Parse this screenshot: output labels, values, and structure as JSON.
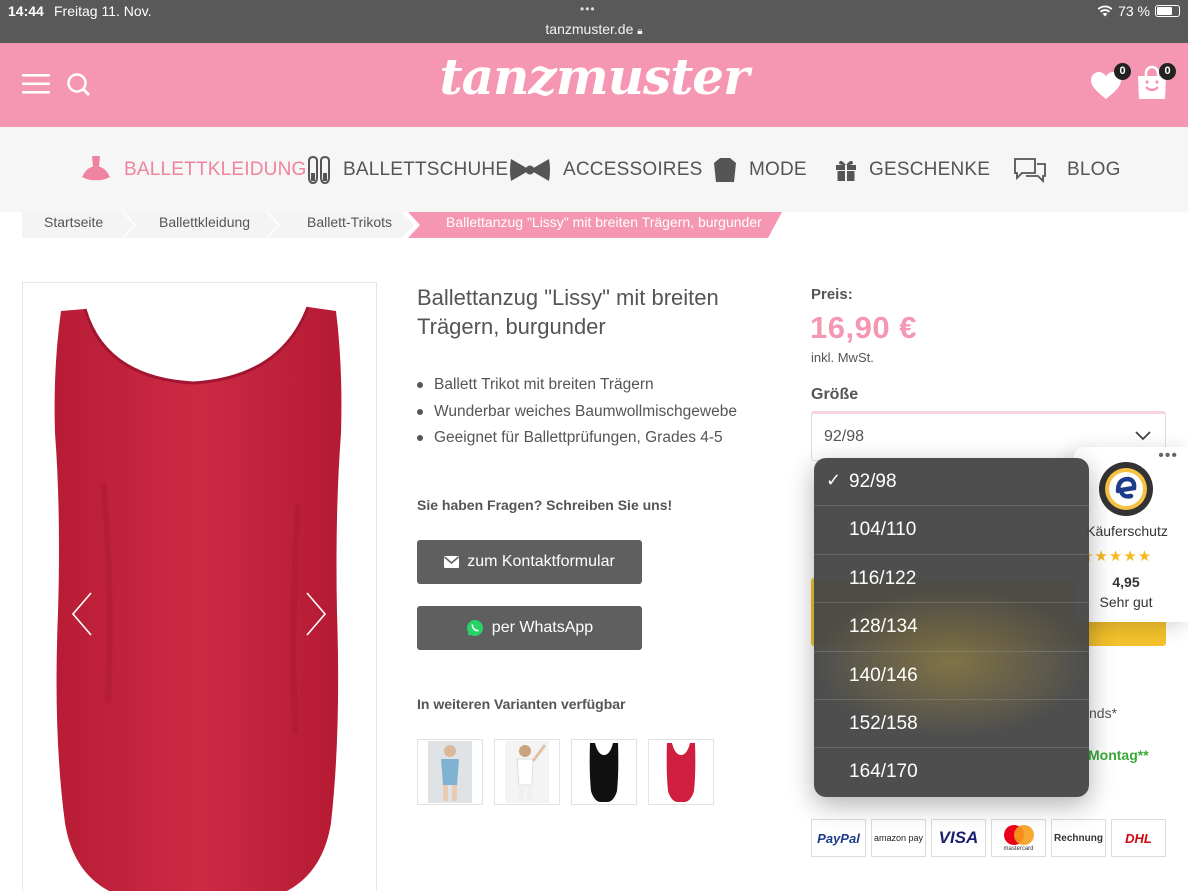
{
  "statusbar": {
    "time": "14:44",
    "date": "Freitag 11. Nov.",
    "url": "tanzmuster.de",
    "battery": "73 %",
    "battery_level": 0.73
  },
  "header": {
    "logo": "tanzmuster",
    "wishlist_count": "0",
    "cart_count": "0"
  },
  "nav": [
    {
      "label": "BALLETTKLEIDUNG",
      "icon": "tutu-icon",
      "active": true
    },
    {
      "label": "BALLETTSCHUHE",
      "icon": "ballet-shoes-icon"
    },
    {
      "label": "ACCESSOIRES",
      "icon": "bow-icon"
    },
    {
      "label": "MODE",
      "icon": "sweater-icon"
    },
    {
      "label": "GESCHENKE",
      "icon": "gift-icon"
    },
    {
      "label": "BLOG",
      "icon": "chat-bubbles-icon"
    }
  ],
  "breadcrumbs": [
    "Startseite",
    "Ballettkleidung",
    "Ballett-Trikots",
    "Ballettanzug \"Lissy\" mit breiten Trägern, burgunder"
  ],
  "product": {
    "title": "Ballettanzug \"Lissy\" mit breiten Trägern, burgunder",
    "bullets": [
      "Ballett Trikot mit breiten Trägern",
      "Wunderbar weiches Baumwollmischgewebe",
      "Geeignet für Ballettprüfungen, Grades 4-5"
    ],
    "question": "Sie haben Fragen? Schreiben Sie uns!",
    "contact_button": "zum Kontaktformular",
    "whatsapp_button": "per WhatsApp",
    "variants_label": "In weiteren Varianten verfügbar",
    "variants": [
      "light-blue",
      "white",
      "black",
      "red"
    ]
  },
  "pricing": {
    "label": "Preis:",
    "price": "16,90 €",
    "tax": "inkl. MwSt.",
    "size_label": "Größe",
    "selected_size": "92/98"
  },
  "size_options": [
    "92/98",
    "104/110",
    "116/122",
    "128/134",
    "140/146",
    "152/158",
    "164/170"
  ],
  "partial_text": {
    "delivery_suffix": "nds*",
    "day": "Montag**"
  },
  "payments": [
    "PayPal",
    "amazon pay",
    "VISA",
    "mastercard",
    "Rechnung",
    "DHL"
  ],
  "trusted_shops": {
    "label": "Käuferschutz",
    "stars": "★★★★★",
    "score": "4,95",
    "verdict": "Sehr gut",
    "more": "•••"
  },
  "colors": {
    "brand_pink": "#f597b3",
    "accent_pink": "#f0839f",
    "button_grey": "#5f5f5f",
    "product_red": "#c8283f",
    "cta_yellow": "#f4c22d"
  }
}
